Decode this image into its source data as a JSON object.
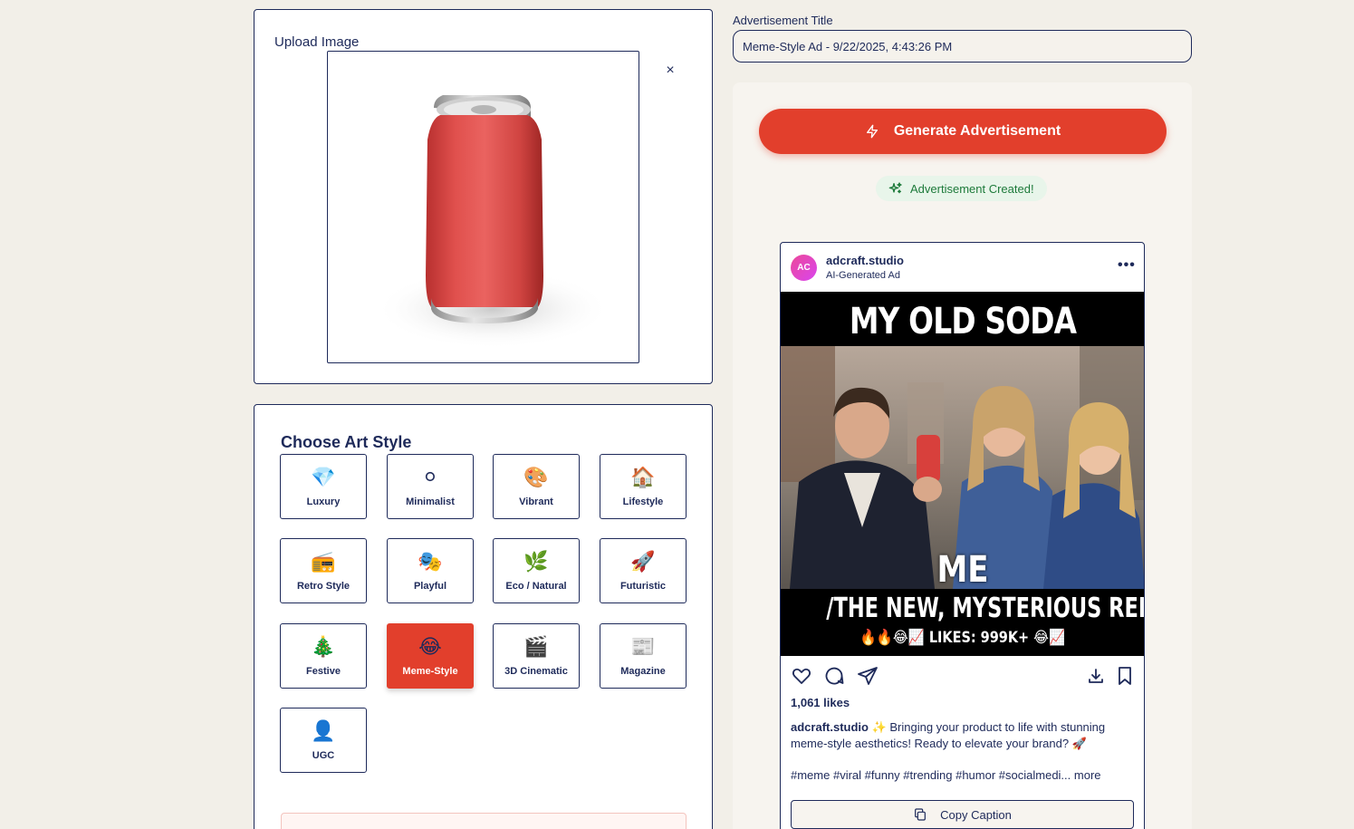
{
  "upload": {
    "label": "Upload Image",
    "close_icon": "close-icon",
    "close_glyph": "×"
  },
  "art_style": {
    "title": "Choose Art Style",
    "selected": "Meme-Style",
    "styles": [
      {
        "label": "Luxury",
        "emoji": "💎"
      },
      {
        "label": "Minimalist",
        "emoji": "⚪"
      },
      {
        "label": "Vibrant",
        "emoji": "🎨"
      },
      {
        "label": "Lifestyle",
        "emoji": "🏠"
      },
      {
        "label": "Retro Style",
        "emoji": "📻"
      },
      {
        "label": "Playful",
        "emoji": "🎭"
      },
      {
        "label": "Eco / Natural",
        "emoji": "🌿"
      },
      {
        "label": "Futuristic",
        "emoji": "🚀"
      },
      {
        "label": "Festive",
        "emoji": "🎄"
      },
      {
        "label": "Meme-Style",
        "emoji": "😂"
      },
      {
        "label": "3D Cinematic",
        "emoji": "🎬"
      },
      {
        "label": "Magazine",
        "emoji": "📰"
      },
      {
        "label": "UGC",
        "emoji": "👤"
      }
    ]
  },
  "ad_title": {
    "label": "Advertisement Title",
    "value": "Meme-Style Ad - 9/22/2025, 4:43:26 PM"
  },
  "generate": {
    "button_label": "Generate Advertisement",
    "status": "Advertisement Created!"
  },
  "post": {
    "avatar_initials": "AC",
    "account": "adcraft.studio",
    "subtitle": "AI-Generated Ad",
    "more_glyph": "•••",
    "meme_top": "MY OLD SODA",
    "meme_middle": "ME",
    "meme_bottom": "/THE NEW, MYSTERIOUS RED CAN",
    "meme_footer": "🔥🔥😂📈  LIKES: 999K+ 😂📈",
    "likes": "1,061 likes",
    "caption_account": "adcraft.studio",
    "caption_text": " ✨ Bringing your product to life with stunning meme-style aesthetics! Ready to elevate your brand? 🚀",
    "hashtags": "#meme #viral #funny #trending #humor #socialmedi... more",
    "copy_label": "Copy Caption"
  },
  "colors": {
    "accent": "#e23f2c",
    "navy": "#1e2a5a",
    "background": "#f2efe8",
    "success": "#1d7a3a"
  }
}
